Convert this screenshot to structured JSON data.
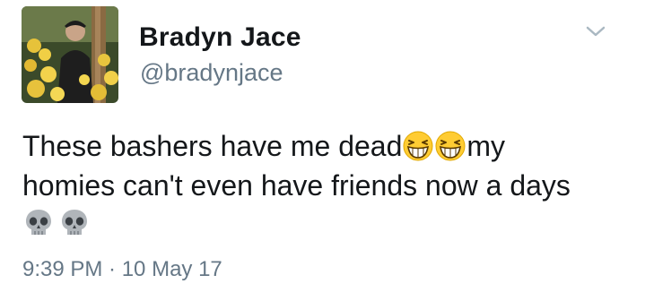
{
  "author": {
    "name": "Bradyn Jace",
    "handle": "@bradynjace"
  },
  "tweet": {
    "line1_text": "These bashers have me dead",
    "line1_after_emoji": "my",
    "line2": "homies can't even have friends now a days",
    "emoji_laughing": "grinning-squinting-face-icon",
    "emoji_skull": "skull-icon"
  },
  "timestamp": "9:39 PM · 10 May 17",
  "colors": {
    "text_primary": "#14171a",
    "text_secondary": "#657786",
    "emoji_yellow": "#ffcc33",
    "skull_gray": "#b0b5ba"
  }
}
